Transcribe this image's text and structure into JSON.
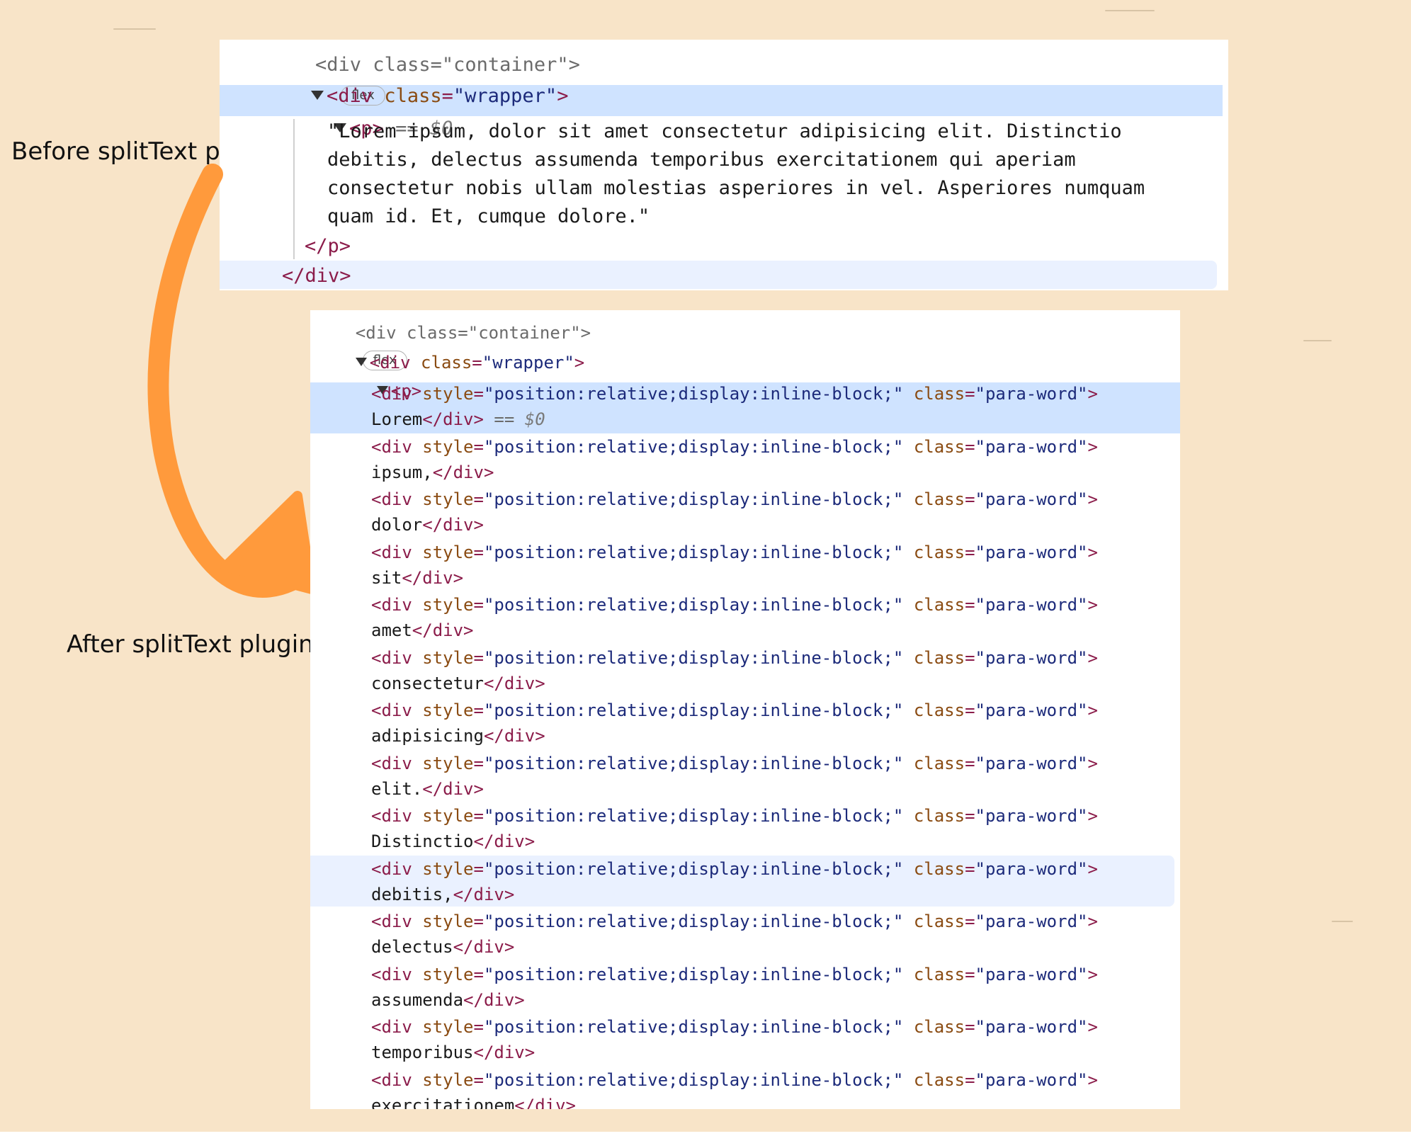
{
  "labels": {
    "before": "Before splitText plugin",
    "after": "After splitText plugin"
  },
  "colors": {
    "background": "#f8e4c8",
    "arrow": "#ff9a3c",
    "selection_highlight": "#cfe3ff",
    "hover_highlight": "#eaf1ff",
    "tag": "#8b1c4a",
    "attribute": "#8a4b12",
    "value": "#1c2a7a"
  },
  "before_panel": {
    "top_partial_line": "<div class=\"container\">",
    "top_partial_badge": "flex",
    "wrapper_open": {
      "tag_open": "<div",
      "attr": "class",
      "value": "\"wrapper\"",
      "close": ">"
    },
    "p_open": {
      "tag": "<p>",
      "suffix": " == ",
      "dollar": "$0"
    },
    "text_lines": [
      "\"Lorem ipsum, dolor sit amet consectetur adipisicing elit. Distinctio",
      "debitis, delectus assumenda temporibus exercitationem qui aperiam",
      "consectetur nobis ullam molestias asperiores in vel. Asperiores numquam",
      "quam id. Et, cumque dolore.\""
    ],
    "p_close": "</p>",
    "div_close": "</div>"
  },
  "after_panel": {
    "top_partial_line": "<div class=\"container\">",
    "top_partial_badge": "flex",
    "wrapper_open": {
      "tag_open": "<div",
      "attr": "class",
      "value": "\"wrapper\"",
      "close": ">"
    },
    "p_open": "<p>",
    "word_div": {
      "tag_open": "<div",
      "style_attr": "style",
      "style_value": "\"position:relative;display:inline-block;\"",
      "class_attr": "class",
      "class_value": "\"para-word\"",
      "close": ">",
      "end_tag": "</div>"
    },
    "selected_suffix": " == ",
    "selected_dollar": "$0",
    "words": [
      "Lorem",
      "ipsum,",
      "dolor",
      "sit",
      "amet",
      "consectetur",
      "adipisicing",
      "elit.",
      "Distinctio",
      "debitis,",
      "delectus",
      "assumenda",
      "temporibus",
      "exercitationem"
    ]
  }
}
